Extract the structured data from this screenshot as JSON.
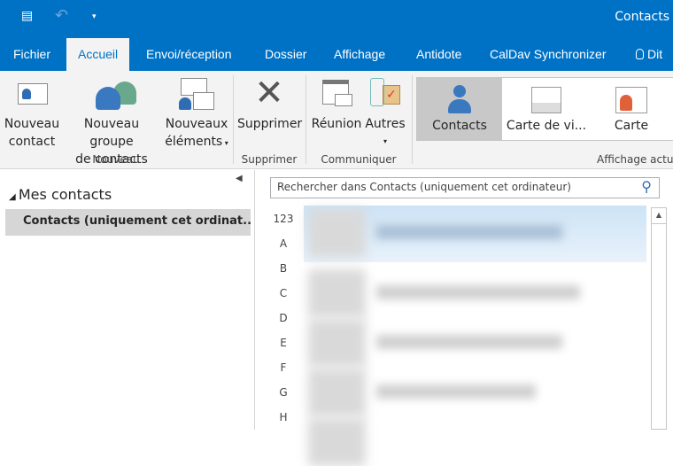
{
  "window_title": "Contacts",
  "tabs": [
    "Fichier",
    "Accueil",
    "Envoi/réception",
    "Dossier",
    "Affichage",
    "Antidote",
    "CalDav Synchronizer",
    "Dit"
  ],
  "ribbon": {
    "new_contact": [
      "Nouveau",
      "contact"
    ],
    "new_group": [
      "Nouveau groupe",
      "de contacts"
    ],
    "new_items": [
      "Nouveaux",
      "éléments"
    ],
    "delete": "Supprimer",
    "meeting": "Réunion",
    "other": "Autres",
    "groups": {
      "new": "Nouveau",
      "delete": "Supprimer",
      "communicate": "Communiquer",
      "view": "Affichage actue"
    },
    "views": [
      "Contacts",
      "Carte de vi...",
      "Carte"
    ]
  },
  "left": {
    "header": "Mes contacts",
    "selected_folder": "Contacts (uniquement cet ordinat..."
  },
  "search": {
    "placeholder": "Rechercher dans Contacts (uniquement cet ordinateur)"
  },
  "letters": [
    "123",
    "A",
    "B",
    "C",
    "D",
    "E",
    "F",
    "G",
    "H"
  ],
  "colors": {
    "accent": "#0072c6"
  }
}
